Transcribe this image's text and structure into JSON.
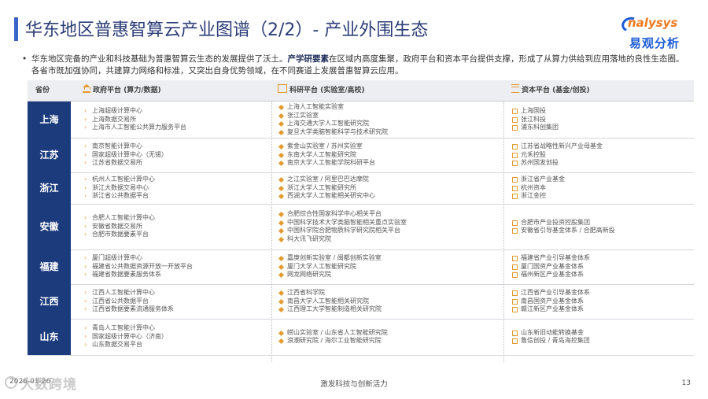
{
  "title": "华东地区普惠智算云产业图谱（2/2）- 产业外围生态",
  "logo": {
    "en": "nalysys",
    "cn": "易观分析"
  },
  "intro": {
    "part1": "华东地区完备的产业和科技基础为普惠智算云生态的发展提供了沃土。",
    "bold": "产学研要素",
    "part2": "在区域内高度集聚，政府平台和资本平台提供支撑，形成了从算力供给到应用落地的良性生态圈。各省市既加强协同，共建算力网络和标准，又突出自身优势领域，在不同赛道上发展普惠智算云应用。"
  },
  "headers": {
    "province": "省份",
    "gov": "政府平台 (算力/数据)",
    "research": "科研平台 (实验室/高校)",
    "capital": "资本平台 (基金/创投)"
  },
  "rows": [
    {
      "province": "上海",
      "gov": [
        "上海超级计算中心",
        "上海数据交易所",
        "上海市人工智能公共算力服务平台"
      ],
      "research": [
        "上海人工智能实验室",
        "张江实验室",
        "上海交通大学人工智能研究院",
        "复旦大学类脑智能科学与技术研究院"
      ],
      "capital": [
        "上海国投",
        "张江科投",
        "浦东科创集团"
      ]
    },
    {
      "province": "江苏",
      "gov": [
        "南京智能计算中心",
        "国家超级计算中心（无锡）",
        "江苏省数据交易所"
      ],
      "research": [
        "紫金山实验室 / 苏州实验室",
        "东南大学人工智能研究院",
        "南京大学人工智能学院科研平台"
      ],
      "capital": [
        "江苏省战略性新兴产业母基金",
        "元禾控股",
        "苏州国发创投"
      ]
    },
    {
      "province": "浙江",
      "gov": [
        "杭州人工智能计算中心",
        "浙江大数据交易中心",
        "浙江省公共数据平台"
      ],
      "research": [
        "之江实验室 / 阿里巴巴达摩院",
        "浙江大学人工智能研究所",
        "西湖大学人工智能相关研究中心"
      ],
      "capital": [
        "浙江省产业基金",
        "杭州资本",
        "浙江金控"
      ]
    },
    {
      "province": "安徽",
      "gov": [
        "合肥人工智能计算中心",
        "安徽省数据交易所",
        "合肥市数据要素平台"
      ],
      "research": [
        "合肥综合性国家科学中心相关平台",
        "中国科学技术大学类脑智能相关重点实验室",
        "中国科学院合肥物质科学研究院相关平台",
        "科大讯飞研究院"
      ],
      "capital": [
        "合肥市产业投资控股集团",
        "安徽省引导基金体系 / 合肥高新投"
      ]
    },
    {
      "province": "福建",
      "gov": [
        "厦门超级计算中心",
        "福建省公共数据资源开放一开放平台",
        "福建省数据要素服务体系"
      ],
      "research": [
        "嘉庚创新实验室 / 闽都创新实验室",
        "厦门大学人工智能研究院",
        "网龙网络研究院"
      ],
      "capital": [
        "福建省产业引导基金体系",
        "厦门国资产业基金体系",
        "福州新区产业基金体系"
      ]
    },
    {
      "province": "江西",
      "gov": [
        "江西人工智能计算中心",
        "江西省公共数据平台",
        "江西省数据要素流通服务体系"
      ],
      "research": [
        "江西省科学院",
        "南昌大学人工智能相关研究院",
        "江西理工大学智能制造相关研究院"
      ],
      "capital": [
        "江西省产业引导基金体系",
        "南昌国资产业基金体系",
        "赣江新区产业基金体系"
      ]
    },
    {
      "province": "山东",
      "gov": [
        "青岛人工智能计算中心",
        "国家超级计算中心（济南）",
        "山东数据交易平台"
      ],
      "research": [
        "崂山实验室 / 山东省人工智能研究院",
        "浪潮研究院 / 海尔工业智能研究院"
      ],
      "capital": [
        "山东新旧动能转换基金",
        "鲁信创投 / 青岛海控集团"
      ]
    }
  ],
  "footer": {
    "date": "2026-01-26",
    "watermark": "大数跨境",
    "center": "激发科技与创新活力",
    "page": "13"
  },
  "colors": {
    "accent": "#1c3b7d",
    "bullet": "#e59a2f",
    "title": "#2b3d77"
  }
}
